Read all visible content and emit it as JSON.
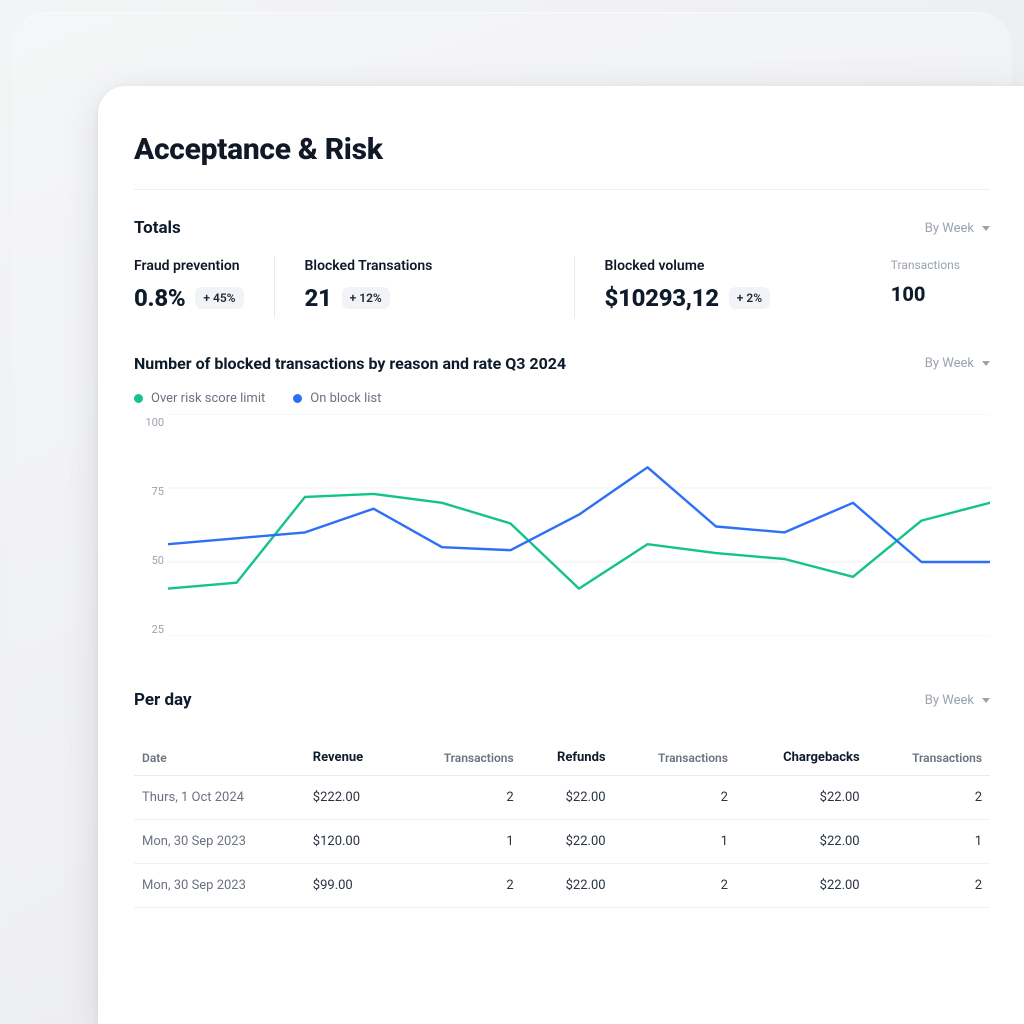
{
  "header": {
    "title": "Acceptance & Risk"
  },
  "selector_options": {
    "current": "By Week"
  },
  "totals": {
    "section_label": "Totals",
    "fraud": {
      "label": "Fraud prevention",
      "value": "0.8%",
      "delta": "+ 45%"
    },
    "blocked": {
      "label": "Blocked Transations",
      "value": "21",
      "delta": "+ 12%"
    },
    "volume": {
      "label": "Blocked volume",
      "value": "$10293,12",
      "delta": "+ 2%"
    },
    "tx": {
      "label": "Transactions",
      "value": "100"
    }
  },
  "chart": {
    "title": "Number of blocked transactions by reason and rate Q3 2024",
    "legend": {
      "a": "Over risk score limit",
      "b": "On block list"
    }
  },
  "chart_data": {
    "type": "line",
    "title": "Number of blocked transactions by reason and rate Q3 2024",
    "xlabel": "",
    "ylabel": "",
    "ylim": [
      25,
      100
    ],
    "yticks": [
      100,
      75,
      50,
      25
    ],
    "x": [
      0,
      1,
      2,
      3,
      4,
      5,
      6,
      7,
      8,
      9,
      10,
      11,
      12
    ],
    "series": [
      {
        "name": "Over risk score limit",
        "color": "#15c28f",
        "values": [
          41,
          43,
          72,
          73,
          70,
          63,
          41,
          56,
          53,
          51,
          45,
          64,
          70
        ]
      },
      {
        "name": "On block list",
        "color": "#2d6ff6",
        "values": [
          56,
          58,
          60,
          68,
          55,
          54,
          66,
          82,
          62,
          60,
          70,
          50,
          50
        ]
      }
    ],
    "legend_position": "top-left",
    "grid": true
  },
  "perday": {
    "section_label": "Per day",
    "columns": {
      "date": "Date",
      "revenue": "Revenue",
      "tx1": "Transactions",
      "refunds": "Refunds",
      "tx2": "Transactions",
      "chargebacks": "Chargebacks",
      "tx3": "Transactions"
    },
    "rows": [
      {
        "date": "Thurs, 1 Oct 2024",
        "revenue": "$222.00",
        "tx1": "2",
        "refunds": "$22.00",
        "tx2": "2",
        "chargebacks": "$22.00",
        "tx3": "2"
      },
      {
        "date": "Mon, 30 Sep 2023",
        "revenue": "$120.00",
        "tx1": "1",
        "refunds": "$22.00",
        "tx2": "1",
        "chargebacks": "$22.00",
        "tx3": "1"
      },
      {
        "date": "Mon, 30 Sep 2023",
        "revenue": "$99.00",
        "tx1": "2",
        "refunds": "$22.00",
        "tx2": "2",
        "chargebacks": "$22.00",
        "tx3": "2"
      }
    ]
  }
}
